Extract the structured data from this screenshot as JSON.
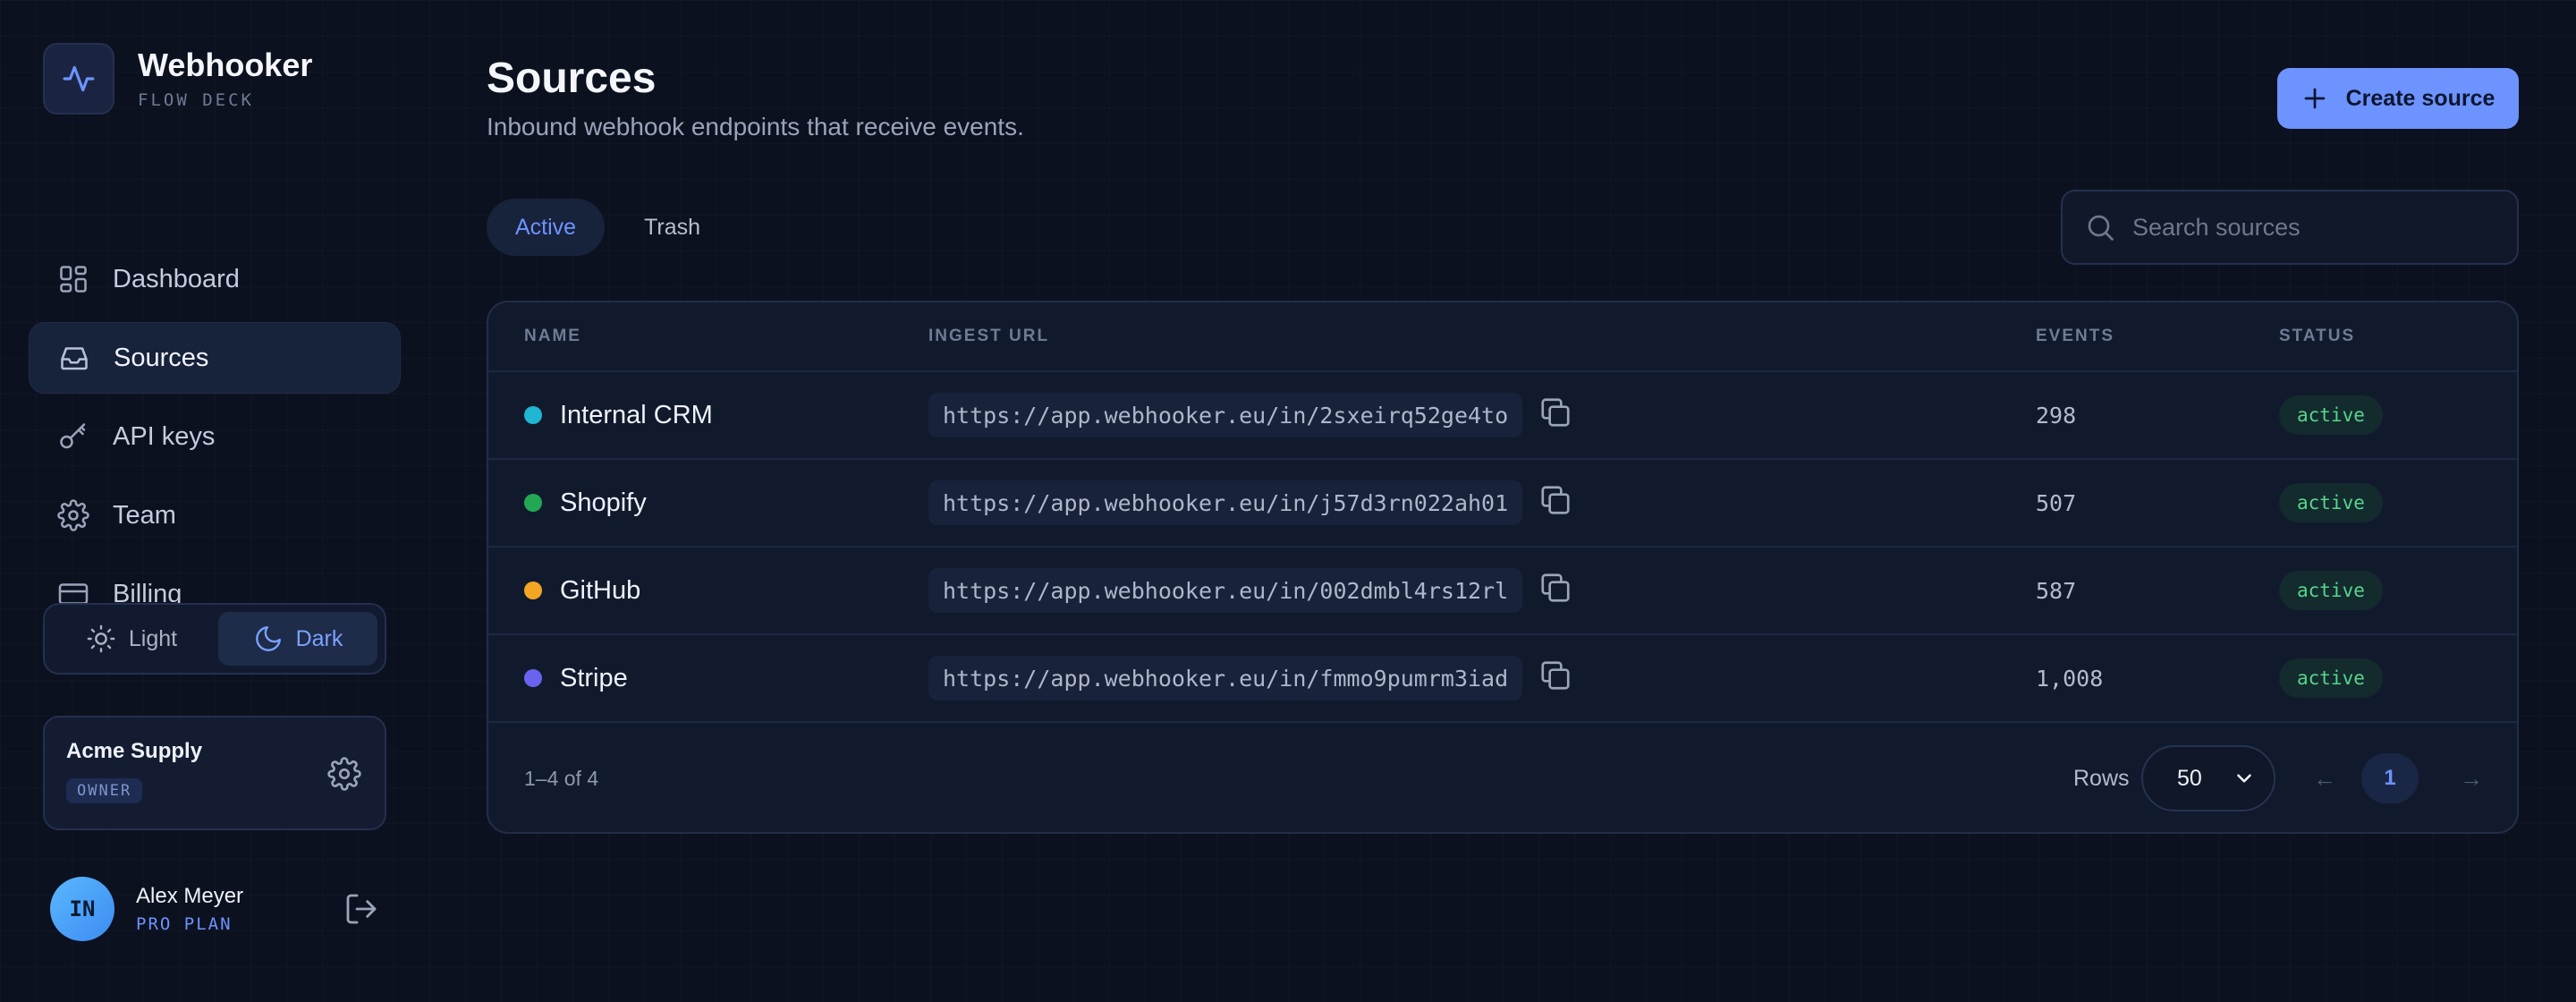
{
  "brand": {
    "name": "Webhooker",
    "subtitle": "FLOW DECK"
  },
  "sidebar": {
    "items": [
      {
        "label": "Dashboard",
        "icon": "dashboard-icon",
        "active": false
      },
      {
        "label": "Sources",
        "icon": "inbox-icon",
        "active": true
      },
      {
        "label": "API keys",
        "icon": "key-icon",
        "active": false
      },
      {
        "label": "Team",
        "icon": "gear-icon",
        "active": false
      },
      {
        "label": "Billing",
        "icon": "credit-card-icon",
        "active": false
      }
    ],
    "theme": {
      "light_label": "Light",
      "dark_label": "Dark",
      "selected": "Dark"
    },
    "org": {
      "name": "Acme Supply",
      "role": "OWNER"
    },
    "user": {
      "initials": "IN",
      "name": "Alex Meyer",
      "plan": "PRO PLAN"
    }
  },
  "header": {
    "title": "Sources",
    "subtitle": "Inbound webhook endpoints that receive events.",
    "create_label": "Create source"
  },
  "tabs": [
    {
      "label": "Active",
      "active": true
    },
    {
      "label": "Trash",
      "active": false
    }
  ],
  "search": {
    "placeholder": "Search sources",
    "value": ""
  },
  "table": {
    "columns": [
      "NAME",
      "INGEST URL",
      "EVENTS",
      "STATUS"
    ],
    "rows": [
      {
        "name": "Internal CRM",
        "color": "#1fb6d1",
        "url": "https://app.webhooker.eu/in/2sxeirq52ge4to",
        "events": "298",
        "status": "active"
      },
      {
        "name": "Shopify",
        "color": "#22a855",
        "url": "https://app.webhooker.eu/in/j57d3rn022ah01",
        "events": "507",
        "status": "active"
      },
      {
        "name": "GitHub",
        "color": "#f5a524",
        "url": "https://app.webhooker.eu/in/002dmbl4rs12rl",
        "events": "587",
        "status": "active"
      },
      {
        "name": "Stripe",
        "color": "#6a63f0",
        "url": "https://app.webhooker.eu/in/fmmo9pumrm3iad",
        "events": "1,008",
        "status": "active"
      }
    ],
    "footer": {
      "count": "1–4 of 4",
      "rows_label": "Rows",
      "rows_value": "50",
      "page": "1",
      "prev": "←",
      "next": "→"
    }
  },
  "colors": {
    "accent": "#6d93ff",
    "status_active": "#57d48f",
    "background": "#0c1120"
  }
}
